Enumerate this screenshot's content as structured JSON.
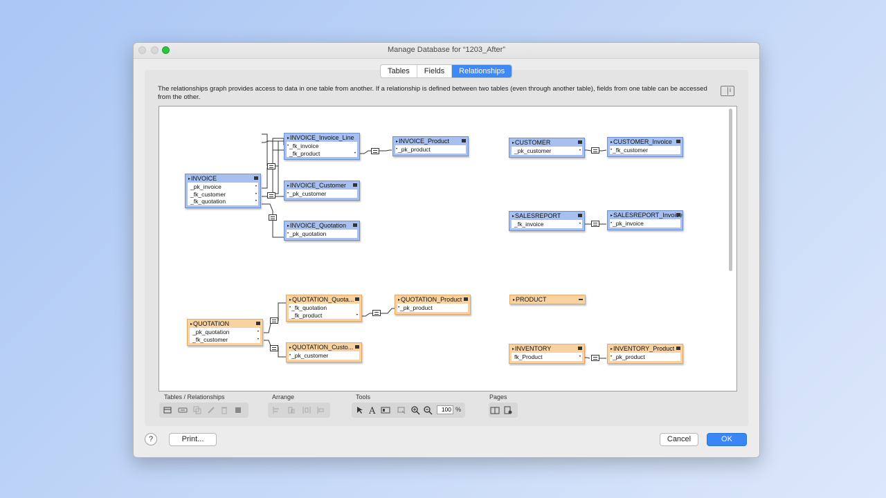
{
  "window": {
    "title": "Manage Database for “1203_After”"
  },
  "tabs": [
    {
      "label": "Tables"
    },
    {
      "label": "Fields"
    },
    {
      "label": "Relationships",
      "active": true
    }
  ],
  "description": "The relationships graph provides access to data in one table from another. If a relationship is defined between two tables (even through another table), fields from one table can be accessed from the other.",
  "tables": {
    "invoice": {
      "name": "INVOICE",
      "fields": [
        "_pk_invoice",
        "_fk_customer",
        "_fk_quotation"
      ]
    },
    "invoice_line": {
      "name": "INVOICE_Invoice_Line",
      "fields": [
        "_fk_invoice",
        "_fk_product"
      ]
    },
    "invoice_product": {
      "name": "INVOICE_Product",
      "fields": [
        "_pk_product"
      ]
    },
    "invoice_customer": {
      "name": "INVOICE_Customer",
      "fields": [
        "_pk_customer"
      ]
    },
    "invoice_quotation": {
      "name": "INVOICE_Quotation",
      "fields": [
        "_pk_quotation"
      ]
    },
    "customer": {
      "name": "CUSTOMER",
      "fields": [
        "_pk_customer"
      ]
    },
    "customer_invoice": {
      "name": "CUSTOMER_Invoice",
      "fields": [
        "_fk_customer"
      ]
    },
    "salesreport": {
      "name": "SALESREPORT",
      "fields": [
        "_fk_invoice"
      ]
    },
    "salesreport_invoice": {
      "name": "SALESREPORT_Invoice",
      "fields": [
        "_pk_invoice"
      ]
    },
    "quotation": {
      "name": "QUOTATION",
      "fields": [
        "_pk_quotation",
        "_fk_customer"
      ]
    },
    "quotation_quota": {
      "name": "QUOTATION_Quota...",
      "fields": [
        "_fk_quotation",
        "_fk_product"
      ]
    },
    "quotation_product": {
      "name": "QUOTATION_Product",
      "fields": [
        "_pk_product"
      ]
    },
    "quotation_custo": {
      "name": "QUOTATION_Custo...",
      "fields": [
        "_pk_customer"
      ]
    },
    "product": {
      "name": "PRODUCT",
      "fields": []
    },
    "inventory": {
      "name": "INVENTORY",
      "fields": [
        "fk_Product"
      ]
    },
    "inventory_product": {
      "name": "INVENTORY_Product",
      "fields": [
        "_pk_product"
      ]
    }
  },
  "toolbar": {
    "groups": {
      "tables_relationships": "Tables / Relationships",
      "arrange": "Arrange",
      "tools": "Tools",
      "pages": "Pages"
    },
    "zoom": "100",
    "zoom_unit": "%"
  },
  "icons": [
    "add-table-icon",
    "add-relationship-icon",
    "duplicate-icon",
    "edit-icon",
    "delete-icon",
    "color-icon",
    "align-left-icon",
    "align-top-icon",
    "distribute-horizontal-icon",
    "resize-icon",
    "selection-tool-icon",
    "text-tool-icon",
    "toggle-display-icon",
    "collapse-icon",
    "zoom-in-icon",
    "zoom-out-icon",
    "page-view-icon",
    "page-setup-icon",
    "info-panel-icon",
    "help-icon"
  ],
  "buttons": {
    "help": "?",
    "print": "Print...",
    "cancel": "Cancel",
    "ok": "OK"
  },
  "colors": {
    "accent": "#3a86f4",
    "blue_table": "#a7c0ef",
    "orange_table": "#f8d2a0",
    "close_dot": "#2ac43f"
  }
}
